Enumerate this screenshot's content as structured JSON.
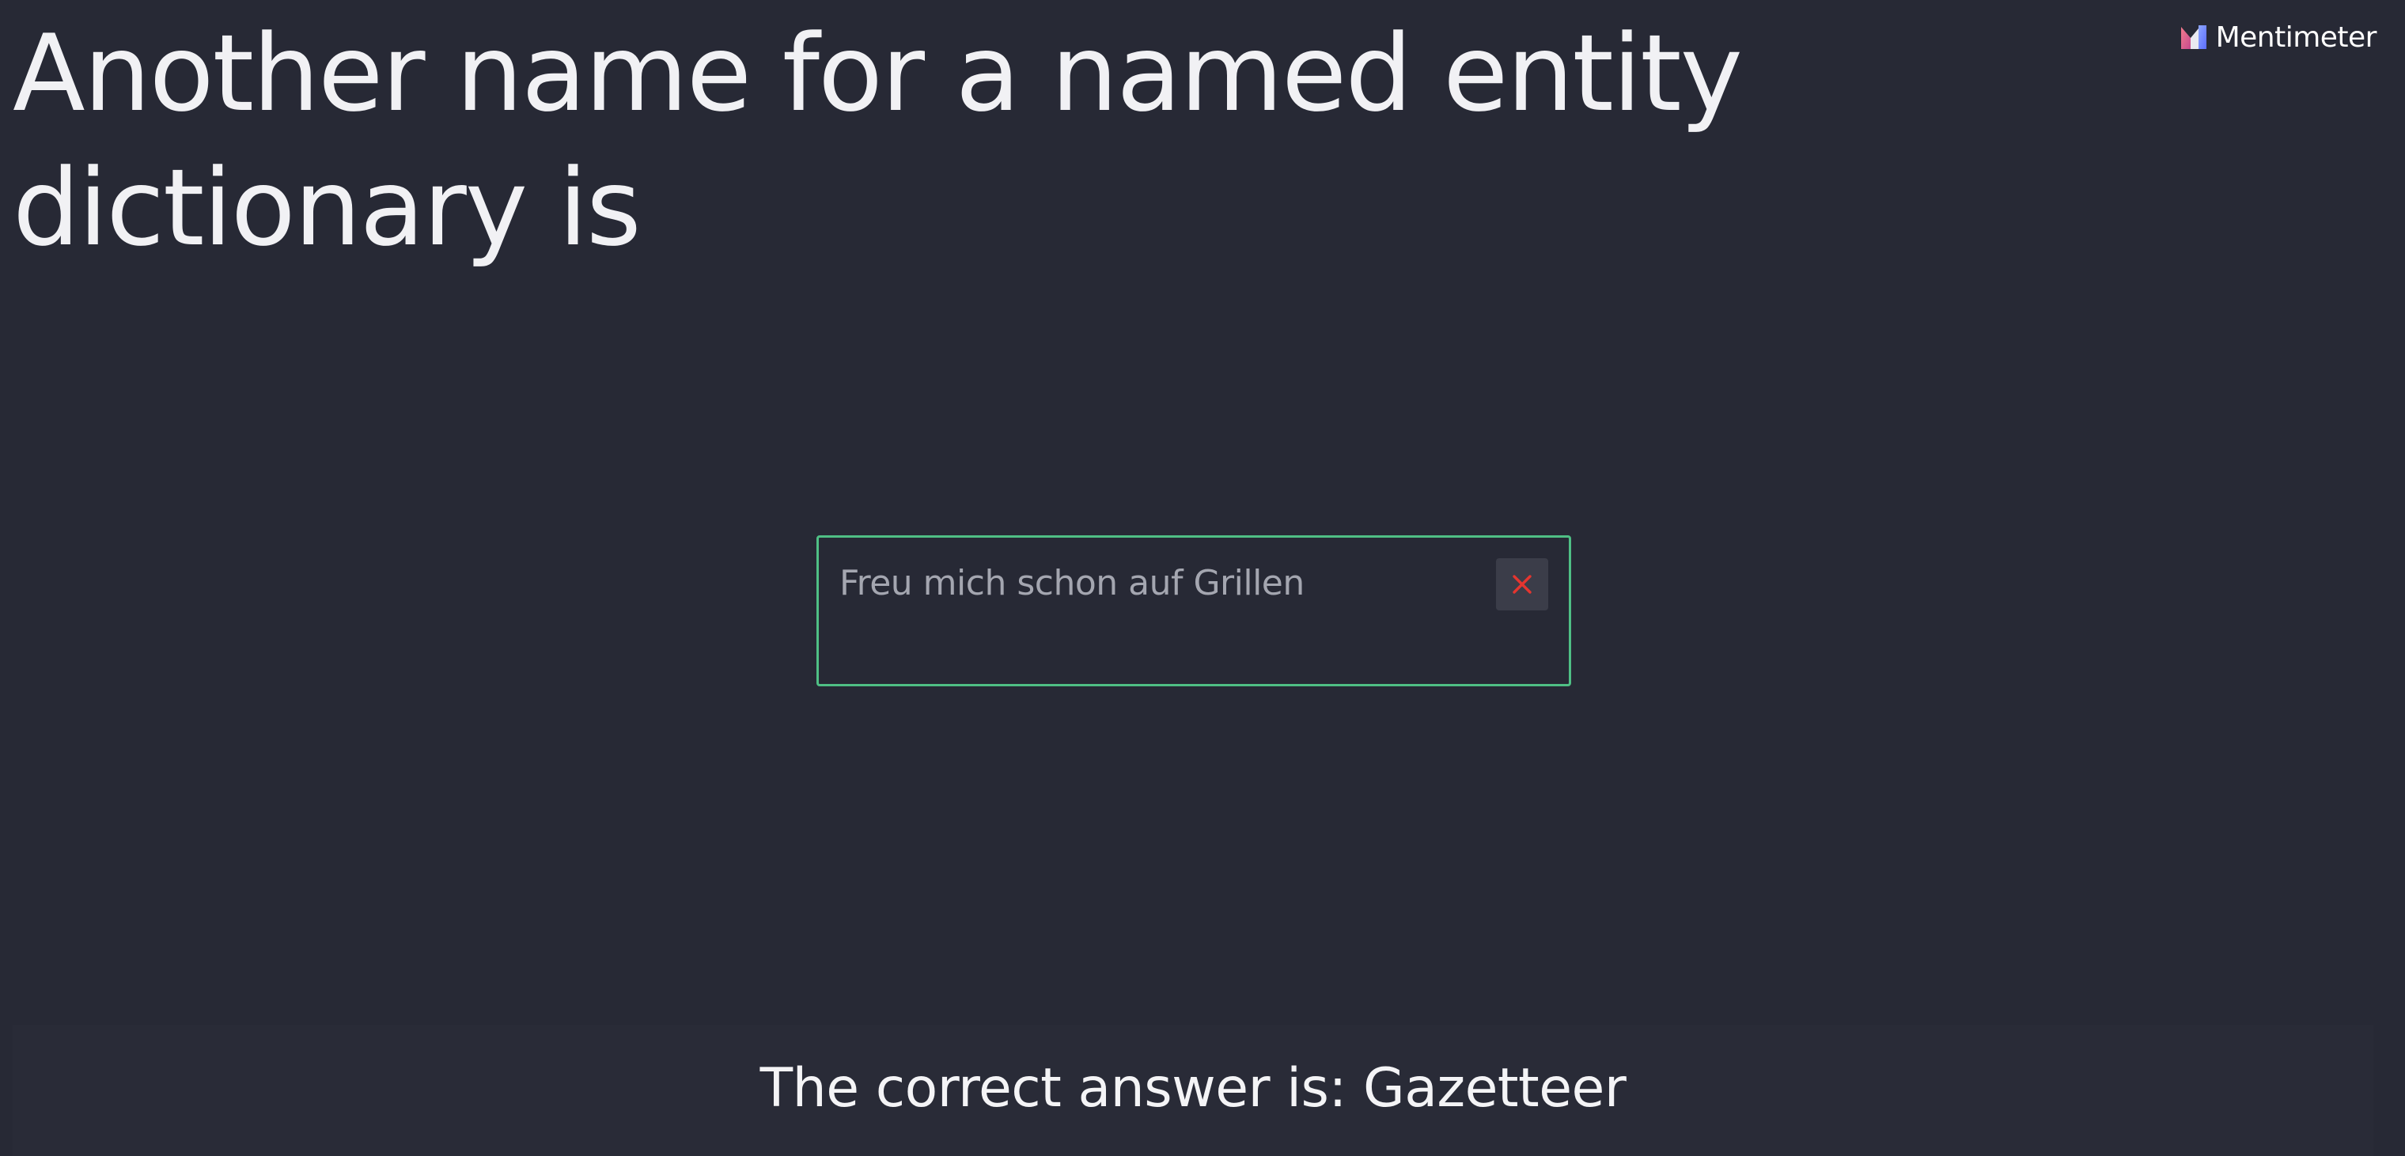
{
  "slide": {
    "question": "Another name for a named entity dictionary is"
  },
  "brand": {
    "name": "Mentimeter",
    "icon": "mentimeter-logo-icon"
  },
  "answer": {
    "text": "Freu mich schon auf Grillen",
    "status_icon": "close-icon",
    "status": "incorrect"
  },
  "result": {
    "text": "The correct answer is: Gazetteer"
  },
  "colors": {
    "background": "#272935",
    "card_border": "#4fbf85",
    "incorrect_mark": "#e5352f",
    "badge_background": "#3b3d49"
  }
}
